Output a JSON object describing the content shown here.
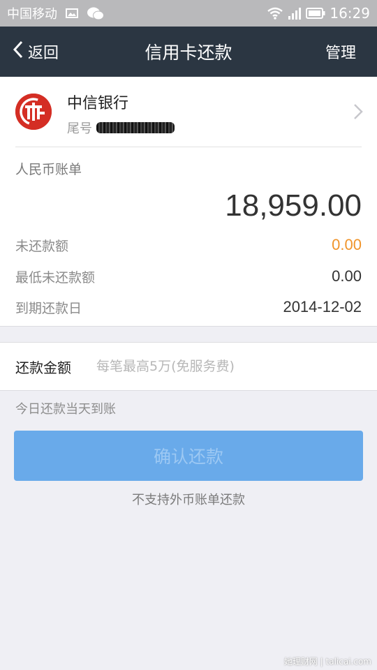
{
  "status_bar": {
    "carrier": "中国移动",
    "time": "16:29",
    "icons": [
      "image-icon",
      "wechat-icon",
      "wifi-icon",
      "signal-icon",
      "battery-icon"
    ]
  },
  "nav": {
    "back_label": "返回",
    "title": "信用卡还款",
    "manage_label": "管理"
  },
  "bank": {
    "name": "中信银行",
    "tail_label": "尾号",
    "logo_color": "#d42e24"
  },
  "bill": {
    "title": "人民币账单",
    "amount": "18,959.00",
    "rows": [
      {
        "label": "未还款额",
        "value": "0.00"
      },
      {
        "label": "最低未还款额",
        "value": "0.00"
      },
      {
        "label": "到期还款日",
        "value": "2014-12-02"
      }
    ]
  },
  "repay": {
    "label": "还款金额",
    "placeholder": "每笔最高5万(免服务费)",
    "value": "",
    "note": "今日还款当天到账",
    "confirm_label": "确认还款",
    "foreign_note": "不支持外币账单还款"
  },
  "watermark": "她理财网 | talicai.com",
  "colors": {
    "nav_bg": "#2b3642",
    "button_bg": "#69aaea",
    "orange_value": "#f0942a",
    "page_bg": "#efeff4"
  }
}
